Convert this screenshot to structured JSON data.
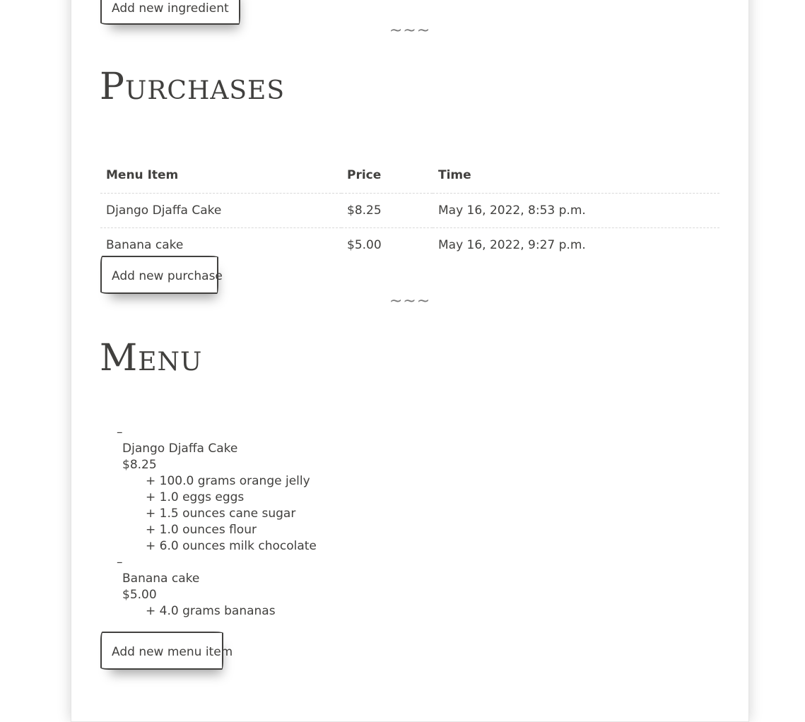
{
  "ingredients_section": {
    "add_button": "Add new ingredient"
  },
  "divider_symbol": "~~~",
  "purchases_section": {
    "title": "Purchases",
    "columns": [
      "Menu Item",
      "Price",
      "Time"
    ],
    "rows": [
      {
        "item": "Django Djaffa Cake",
        "price": "$8.25",
        "time": "May 16, 2022, 8:53 p.m."
      },
      {
        "item": "Banana cake",
        "price": "$5.00",
        "time": "May 16, 2022, 9:27 p.m."
      }
    ],
    "add_button": "Add new purchase"
  },
  "menu_section": {
    "title": "Menu",
    "items": [
      {
        "bullet": "–",
        "name": "Django Djaffa Cake",
        "price": "$8.25",
        "ingredients": [
          "+ 100.0 grams orange jelly",
          "+ 1.0 eggs eggs",
          "+ 1.5 ounces cane sugar",
          "+ 1.0 ounces flour",
          "+ 6.0 ounces milk chocolate"
        ]
      },
      {
        "bullet": "–",
        "name": "Banana cake",
        "price": "$5.00",
        "ingredients": [
          "+ 4.0 grams bananas"
        ]
      }
    ],
    "add_button": "Add new menu item"
  }
}
